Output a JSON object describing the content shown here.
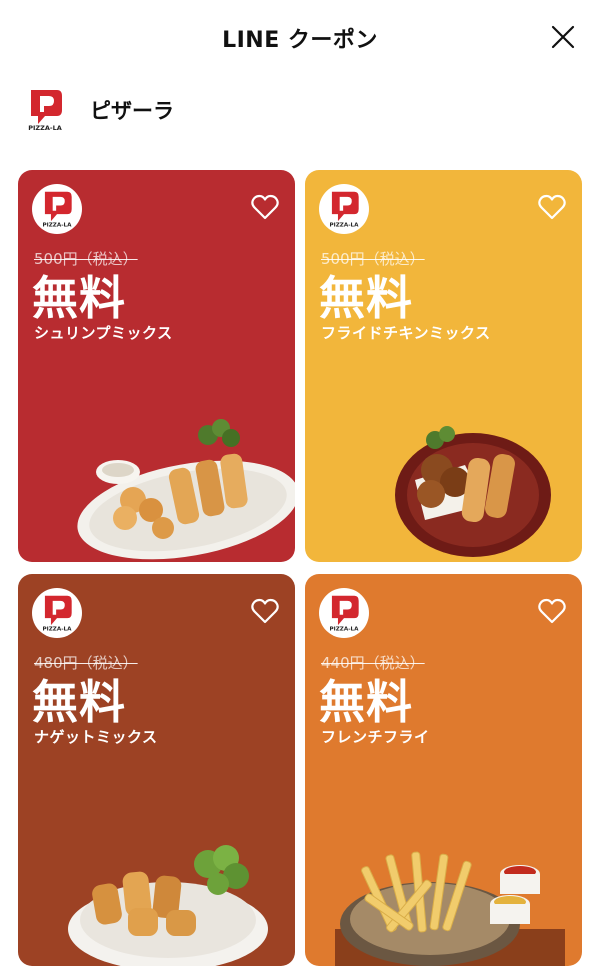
{
  "header": {
    "title": "LINE クーポン"
  },
  "brand": {
    "name": "ピザーラ",
    "logo_text": "PIZZA-LA"
  },
  "colors": {
    "red": "#b82c30",
    "yellow": "#f2b63b",
    "brown": "#9d4224",
    "orange": "#df7a2e"
  },
  "coupons": [
    {
      "price": "500円（税込）",
      "free_label": "無料",
      "item": "シュリンプミックス"
    },
    {
      "price": "500円（税込）",
      "free_label": "無料",
      "item": "フライドチキンミックス"
    },
    {
      "price": "480円（税込）",
      "free_label": "無料",
      "item": "ナゲットミックス"
    },
    {
      "price": "440円（税込）",
      "free_label": "無料",
      "item": "フレンチフライ"
    }
  ]
}
